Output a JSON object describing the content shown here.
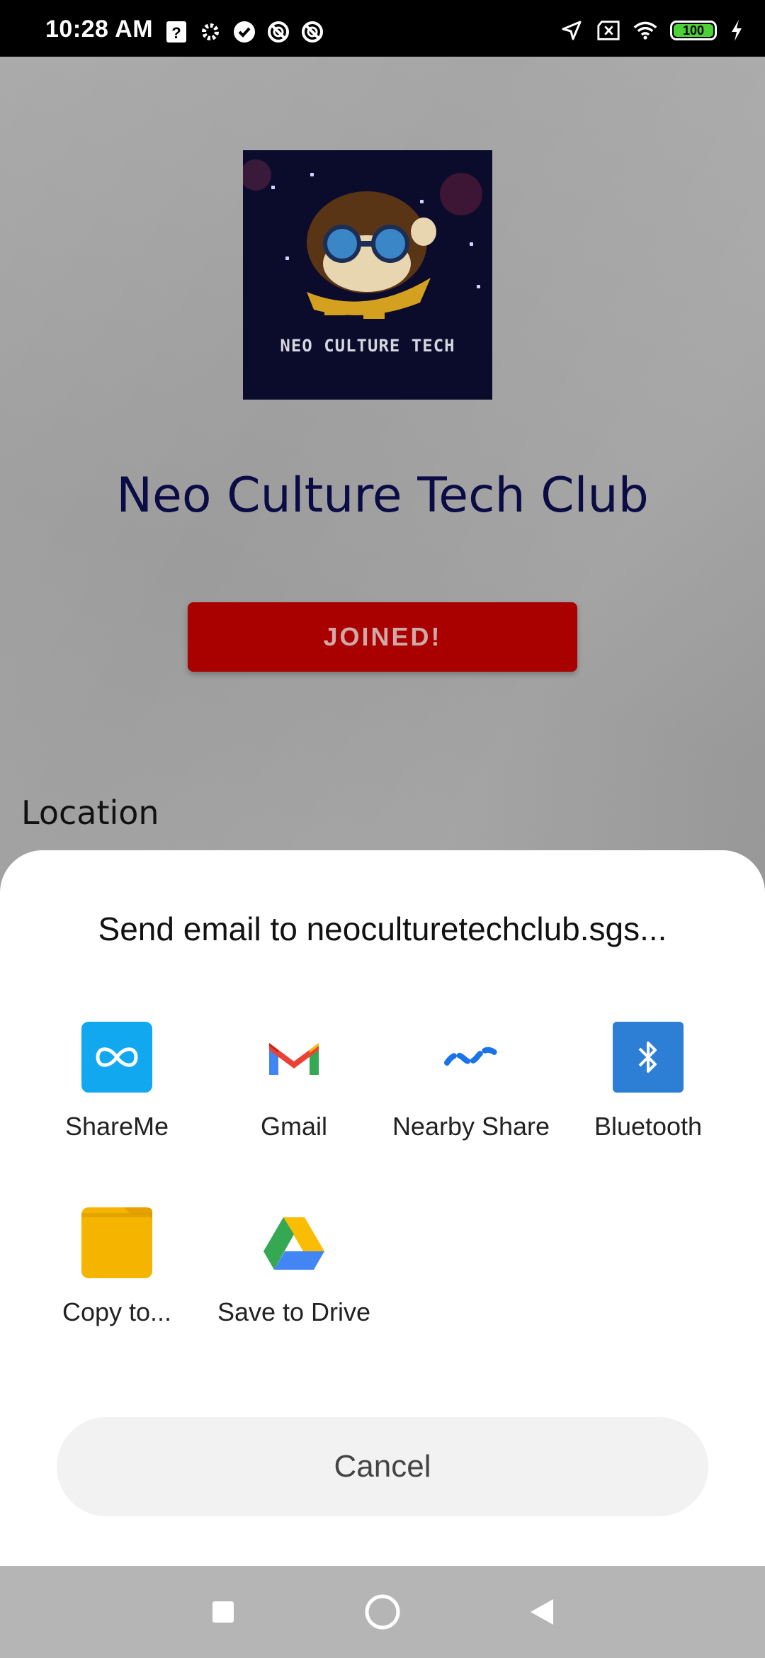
{
  "status_bar": {
    "time": "10:28 AM",
    "battery": "100",
    "left_icons": [
      "help-icon",
      "settings-icon",
      "check-circle-icon",
      "no-tracking-icon",
      "no-tracking-icon"
    ],
    "right_icons": [
      "location-arrow-icon",
      "no-sim-icon",
      "wifi-icon",
      "battery-icon",
      "charging-icon"
    ]
  },
  "club": {
    "logo_text": "NEO CULTURE TECH",
    "name": "Neo Culture Tech Club",
    "joined_label": "JOINED!",
    "section_label": "Location"
  },
  "share_sheet": {
    "title": "Send email to neoculturetechclub.sgs...",
    "apps": [
      {
        "label": "ShareMe",
        "icon": "shareme-icon"
      },
      {
        "label": "Gmail",
        "icon": "gmail-icon"
      },
      {
        "label": "Nearby Share",
        "icon": "nearby-share-icon"
      },
      {
        "label": "Bluetooth",
        "icon": "bluetooth-icon"
      },
      {
        "label": "Copy to...",
        "icon": "folder-icon"
      },
      {
        "label": "Save to Drive",
        "icon": "drive-icon"
      }
    ],
    "cancel_label": "Cancel"
  },
  "nav_bar": {
    "buttons": [
      "recents-square-icon",
      "home-circle-icon",
      "back-triangle-icon"
    ]
  },
  "colors": {
    "status_bar_bg": "#000000",
    "title_color": "#0b0b45",
    "joined_button": "#a90000",
    "shareme": "#12a8f0",
    "bluetooth": "#2d7fd6",
    "folder": "#f4b400"
  }
}
